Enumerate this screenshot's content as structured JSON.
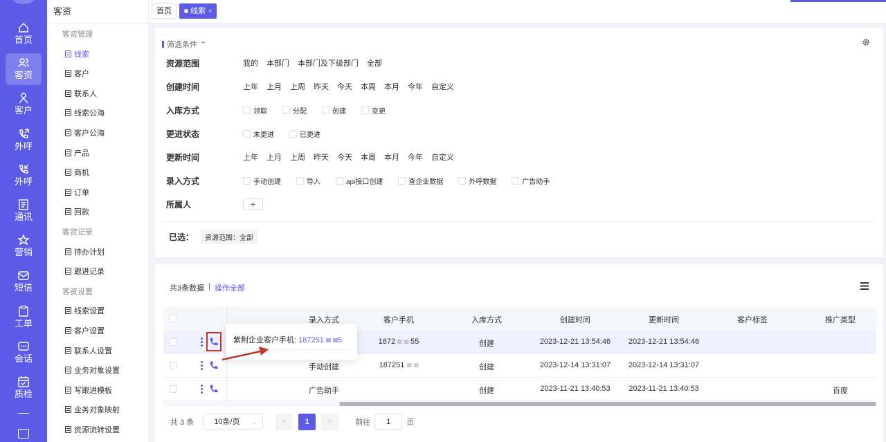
{
  "rail": {
    "items": [
      {
        "label": "首页",
        "icon": "home-icon"
      },
      {
        "label": "客资",
        "icon": "users-icon"
      },
      {
        "label": "客户",
        "icon": "user-icon"
      },
      {
        "label": "外呼",
        "icon": "phone-outgoing-icon"
      },
      {
        "label": "外呼",
        "icon": "phone-callback-icon"
      },
      {
        "label": "通讯",
        "icon": "contacts-icon"
      },
      {
        "label": "营销",
        "icon": "marketing-icon"
      },
      {
        "label": "短信",
        "icon": "message-icon"
      },
      {
        "label": "工单",
        "icon": "clipboard-icon"
      },
      {
        "label": "会话",
        "icon": "chat-icon"
      },
      {
        "label": "质检",
        "icon": "calendar-check-icon"
      }
    ]
  },
  "submenu": {
    "title": "客资",
    "groups": [
      {
        "title": "客资管理",
        "items": [
          "线索",
          "客户",
          "联系人",
          "线索公海",
          "客户公海",
          "产品",
          "商机",
          "订单",
          "回款"
        ]
      },
      {
        "title": "客资记录",
        "items": [
          "待办计划",
          "跟进记录"
        ]
      },
      {
        "title": "客资设置",
        "items": [
          "线索设置",
          "客户设置",
          "联系人设置",
          "业务对象设置",
          "写跟进模板",
          "业务对象映射",
          "资源流转设置"
        ]
      }
    ]
  },
  "tabs": {
    "home": "首页",
    "current": "线索",
    "close": "×"
  },
  "filter": {
    "header": "筛选条件",
    "rows": [
      {
        "label": "资源范围",
        "options": [
          "我的",
          "本部门",
          "本部门及下级部门",
          "全部"
        ]
      },
      {
        "label": "创建时间",
        "options": [
          "上年",
          "上月",
          "上周",
          "昨天",
          "今天",
          "本周",
          "本月",
          "今年",
          "自定义"
        ]
      },
      {
        "label": "入库方式",
        "checks": [
          "领取",
          "分配",
          "创建",
          "变更"
        ]
      },
      {
        "label": "更进状态",
        "checks": [
          "未更进",
          "已更进"
        ]
      },
      {
        "label": "更新时间",
        "options": [
          "上年",
          "上月",
          "上周",
          "昨天",
          "今天",
          "本周",
          "本月",
          "今年",
          "自定义"
        ]
      },
      {
        "label": "录入方式",
        "checks": [
          "手动创建",
          "导入",
          "api接口创建",
          "查企业数据",
          "外呼数据",
          "广告助手"
        ]
      },
      {
        "label": "所属人",
        "plus": "+"
      }
    ],
    "selected_label": "已选：",
    "selected_tag": "资源范围：全部"
  },
  "table": {
    "summary": "共3条数据",
    "divider": "|",
    "action_all": "操作全部",
    "columns": [
      "录入方式",
      "客户手机",
      "入库方式",
      "创建时间",
      "更新时间",
      "客户标签",
      "推广类型"
    ],
    "rows": [
      {
        "entry": "",
        "phone": "1872",
        "phone_tail": "55",
        "storage": "创建",
        "created": "2023-12-21 13:54:46",
        "updated": "2023-12-21 13:54:46",
        "tag": "",
        "promo": ""
      },
      {
        "entry": "手动创建",
        "phone": "187251",
        "phone_tail": "",
        "storage": "创建",
        "created": "2023-12-14 13:31:07",
        "updated": "2023-12-14 13:31:07",
        "tag": "",
        "promo": ""
      },
      {
        "entry": "广告助手",
        "phone": "",
        "phone_tail": "",
        "storage": "创建",
        "created": "2023-11-21 13:40:53",
        "updated": "2023-11-21 13:40:53",
        "tag": "",
        "promo": "百度"
      }
    ]
  },
  "popover": {
    "label": "紫荆企业客户手机:",
    "number": "187251",
    "tail": "5"
  },
  "pager": {
    "total": "共 3 条",
    "size": "10条/页",
    "prev": "<",
    "page": "1",
    "next": ">",
    "goto": "前往",
    "goto_value": "1",
    "goto_suffix": "页"
  },
  "colors": {
    "primary": "#5b5be8",
    "highlight": "#f0f1ff",
    "annotation": "#c0392b"
  }
}
